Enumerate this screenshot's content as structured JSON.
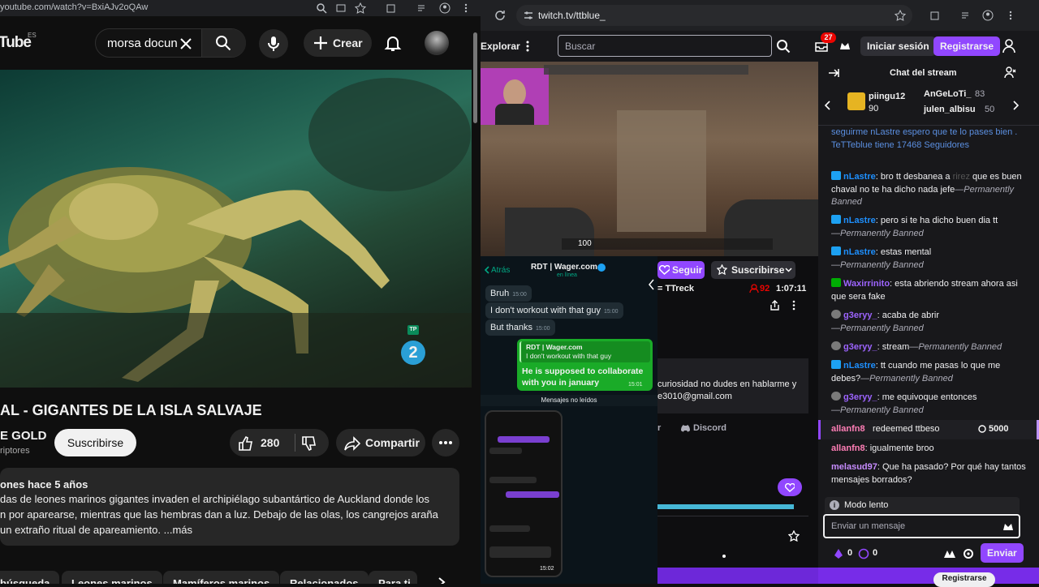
{
  "youtube": {
    "url": "youtube.com/watch?v=BxiAJv2oQAw",
    "logo": "Tube",
    "logo_region": "ES",
    "search_query": "morsa docun",
    "create_label": "Crear",
    "video_title": "AL - GIGANTES DE LA ISLA SALVAJE",
    "channel_name": "E GOLD",
    "channel_subs": "riptores",
    "subscribe_label": "Suscribirse",
    "likes": "280",
    "share_label": "Compartir",
    "badge_number": "2",
    "badge_tp": "TP",
    "desc_meta": "ones  hace 5 años",
    "desc_line1": "das de leones marinos gigantes invaden el archipiélago subantártico de Auckland donde los",
    "desc_line2": "n por aparearse, mientras que las hembras dan a luz. Debajo de las olas, los cangrejos araña",
    "desc_line3": "un extraño ritual de apareamiento. ...más",
    "chips": [
      "búsqueda",
      "Leones marinos",
      "Mamíferos marinos",
      "Relacionados",
      "Para ti"
    ]
  },
  "twitch": {
    "url": "twitch.tv/ttblue_",
    "explore": "Explorar",
    "search_placeholder": "Buscar",
    "notif_count": "27",
    "login": "Iniciar sesión",
    "register": "Registrarse",
    "follow": "Seguir",
    "subscribe": "Suscribirse",
    "streamer_title": "= TTreck",
    "viewers": "92",
    "uptime": "1:07:11",
    "about_line1": "curiosidad no dudes en hablarme y",
    "about_line2": "e3010@gmail.com",
    "discord": "Discord",
    "social_r": "r",
    "hud_health": "100"
  },
  "whatsapp": {
    "back": "Atrás",
    "contact": "RDT | Wager.com",
    "status": "en línea",
    "msgs": [
      {
        "text": "Bruh",
        "time": "15:00"
      },
      {
        "text": "I don't workout with that guy",
        "time": "15:00"
      },
      {
        "text": "But thanks",
        "time": "15:00"
      }
    ],
    "reply_quote_name": "RDT | Wager.com",
    "reply_quote_text": "I don't workout with that guy",
    "reply_text": "He is supposed to collaborate with you in january",
    "reply_time": "15:01",
    "unread": "Mensajes no leídos",
    "phone_time": "15:02"
  },
  "chat": {
    "title": "Chat del stream",
    "gifters": [
      {
        "name": "piingu12",
        "count": "90"
      },
      {
        "name": "AnGeLoTi_",
        "count": "83"
      },
      {
        "name": "julen_albisu",
        "count": "50"
      }
    ],
    "bot_msg1": "seguirme nLastre",
    "bot_msg2": "espero que te lo pases bien . TeTTeblue tiene 17468 Seguidores",
    "m1_user": "nLastre",
    "m1_text": "bro tt desbanea a",
    "m1_hidden": "rirez",
    "m1_text2": "que es buen chaval no te ha dicho nada jefe",
    "ban": "—Permanently Banned",
    "m2_user": "nLastre",
    "m2_text": "pero si te ha dicho buen dia tt",
    "m3_user": "nLastre",
    "m3_text": "estas mental",
    "m4_user": "Waxirrinito",
    "m4_text": "esta abriendo stream ahora asi que sera fake",
    "m5_user": "g3eryy_",
    "m5_text": "acaba de abrir",
    "m6_user": "g3eryy_",
    "m6_text": "stream",
    "m7_user": "nLastre",
    "m7_text": "tt cuando me pasas lo que me debes?",
    "m8_user": "g3eryy_",
    "m8_text": "me equivoque entonces",
    "redeem_user": "allanfn8",
    "redeem_text": "redeemed ttbeso",
    "redeem_cost": "5000",
    "m9_user": "allanfn8",
    "m9_text": "igualmente broo",
    "m10_user": "melasud97",
    "m10_text": "Que ha pasado? Por qué hay tantos mensajes borrados?",
    "slow_mode": "Modo lento",
    "input_placeholder": "Enviar un mensaje",
    "points": "0",
    "points2": "0",
    "send": "Enviar",
    "register_bottom": "Registrarse"
  },
  "colors": {
    "twitch_purple": "#9147ff",
    "yt_bg": "#0f0f0f",
    "chat_bg": "#18181b",
    "wa_green": "#005c4b"
  }
}
